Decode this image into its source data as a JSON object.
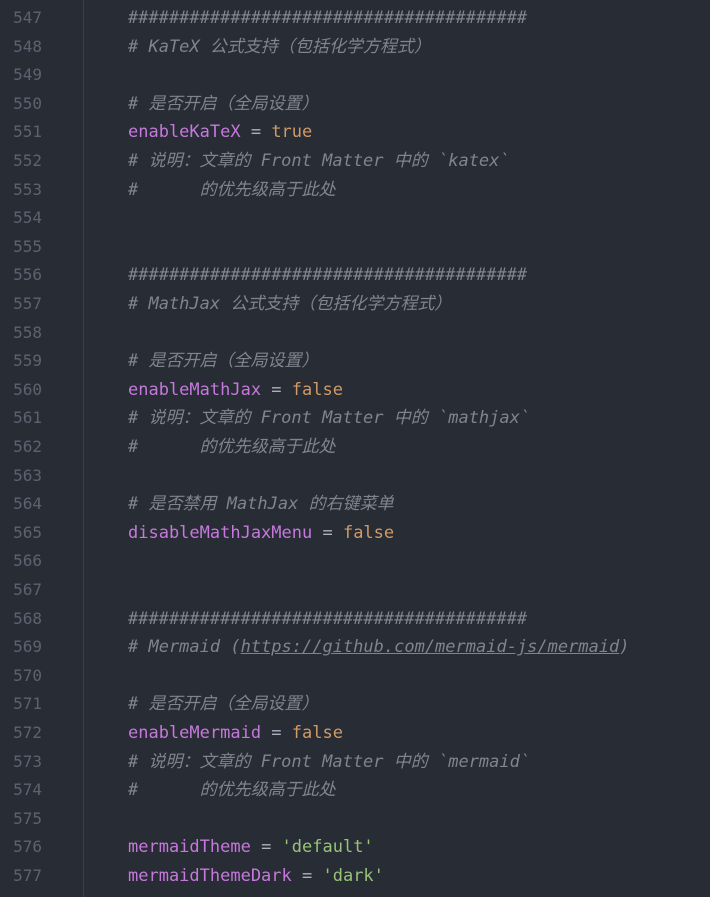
{
  "editor": {
    "lines": [
      {
        "num": "547",
        "kind": "comment",
        "text": "#######################################"
      },
      {
        "num": "548",
        "kind": "comment",
        "text": "# KaTeX 公式支持（包括化学方程式）"
      },
      {
        "num": "549",
        "kind": "blank"
      },
      {
        "num": "550",
        "kind": "comment",
        "text": "# 是否开启（全局设置）"
      },
      {
        "num": "551",
        "kind": "assign",
        "key": "enableKaTeX",
        "op": " = ",
        "value": "true",
        "vtype": "bool"
      },
      {
        "num": "552",
        "kind": "comment",
        "text": "# 说明：文章的 Front Matter 中的 `katex`"
      },
      {
        "num": "553",
        "kind": "comment",
        "text": "#      的优先级高于此处"
      },
      {
        "num": "554",
        "kind": "blank"
      },
      {
        "num": "555",
        "kind": "blank"
      },
      {
        "num": "556",
        "kind": "comment",
        "text": "#######################################"
      },
      {
        "num": "557",
        "kind": "comment",
        "text": "# MathJax 公式支持（包括化学方程式）"
      },
      {
        "num": "558",
        "kind": "blank"
      },
      {
        "num": "559",
        "kind": "comment",
        "text": "# 是否开启（全局设置）"
      },
      {
        "num": "560",
        "kind": "assign",
        "key": "enableMathJax",
        "op": " = ",
        "value": "false",
        "vtype": "bool"
      },
      {
        "num": "561",
        "kind": "comment",
        "text": "# 说明：文章的 Front Matter 中的 `mathjax`"
      },
      {
        "num": "562",
        "kind": "comment",
        "text": "#      的优先级高于此处"
      },
      {
        "num": "563",
        "kind": "blank"
      },
      {
        "num": "564",
        "kind": "comment",
        "text": "# 是否禁用 MathJax 的右键菜单"
      },
      {
        "num": "565",
        "kind": "assign",
        "key": "disableMathJaxMenu",
        "op": " = ",
        "value": "false",
        "vtype": "bool"
      },
      {
        "num": "566",
        "kind": "blank"
      },
      {
        "num": "567",
        "kind": "blank"
      },
      {
        "num": "568",
        "kind": "comment",
        "text": "#######################################"
      },
      {
        "num": "569",
        "kind": "comment_link",
        "prefix": "# Mermaid (",
        "link": "https://github.com/mermaid-js/mermaid",
        "suffix": ")"
      },
      {
        "num": "570",
        "kind": "blank"
      },
      {
        "num": "571",
        "kind": "comment",
        "text": "# 是否开启（全局设置）"
      },
      {
        "num": "572",
        "kind": "assign",
        "key": "enableMermaid",
        "op": " = ",
        "value": "false",
        "vtype": "bool"
      },
      {
        "num": "573",
        "kind": "comment",
        "text": "# 说明：文章的 Front Matter 中的 `mermaid`"
      },
      {
        "num": "574",
        "kind": "comment",
        "text": "#      的优先级高于此处"
      },
      {
        "num": "575",
        "kind": "blank"
      },
      {
        "num": "576",
        "kind": "assign",
        "key": "mermaidTheme",
        "op": " = ",
        "value": "'default'",
        "vtype": "str"
      },
      {
        "num": "577",
        "kind": "assign",
        "key": "mermaidThemeDark",
        "op": " = ",
        "value": "'dark'",
        "vtype": "str"
      }
    ]
  },
  "colors": {
    "background": "#282c34",
    "line_number": "#5c6370",
    "comment": "#7f848e",
    "key": "#c678dd",
    "boolean": "#d19a66",
    "string": "#98c379"
  }
}
